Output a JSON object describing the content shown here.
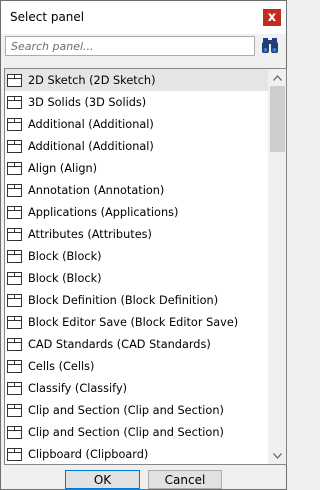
{
  "window": {
    "title": "Select panel",
    "close_glyph": "x"
  },
  "search": {
    "placeholder": "Search panel...",
    "icon": "binoculars-icon"
  },
  "list": {
    "items": [
      {
        "label": "2D Sketch (2D Sketch)",
        "selected": true
      },
      {
        "label": "3D Solids (3D Solids)"
      },
      {
        "label": "Additional (Additional)"
      },
      {
        "label": "Additional (Additional)"
      },
      {
        "label": "Align (Align)"
      },
      {
        "label": "Annotation (Annotation)"
      },
      {
        "label": "Applications (Applications)"
      },
      {
        "label": "Attributes (Attributes)"
      },
      {
        "label": "Block (Block)"
      },
      {
        "label": "Block (Block)"
      },
      {
        "label": "Block Definition (Block Definition)"
      },
      {
        "label": "Block Editor Save (Block Editor Save)"
      },
      {
        "label": "CAD Standards (CAD Standards)"
      },
      {
        "label": "Cells (Cells)"
      },
      {
        "label": "Classify (Classify)"
      },
      {
        "label": "Clip and Section (Clip and Section)"
      },
      {
        "label": "Clip and Section (Clip and Section)"
      },
      {
        "label": "Clipboard (Clipboard)"
      }
    ]
  },
  "buttons": {
    "ok": "OK",
    "cancel": "Cancel"
  },
  "colors": {
    "close": "#c42b1c",
    "selected_row": "#e5e5e5",
    "ok_border": "#0078d7"
  }
}
